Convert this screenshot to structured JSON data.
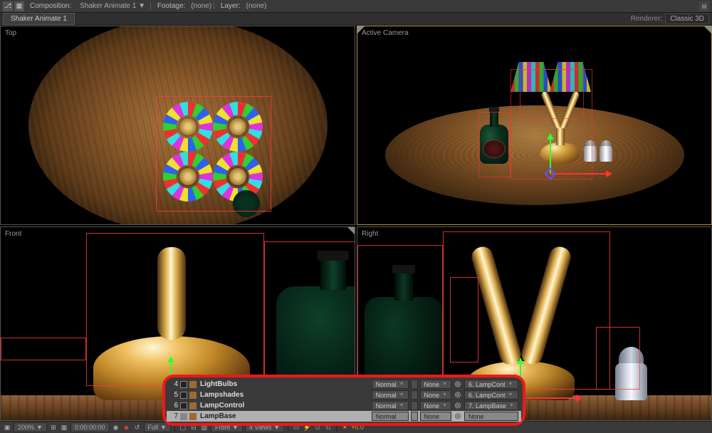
{
  "header": {
    "comp_label": "Composition:",
    "comp_name": "Shaker Animate 1",
    "footage_label": "Footage:",
    "footage_value": "(none)",
    "layer_label": "Layer:",
    "layer_value": "(none)"
  },
  "tab": {
    "name": "Shaker Animate 1"
  },
  "renderer": {
    "label": "Renderer:",
    "value": "Classic 3D"
  },
  "viewports": {
    "top": "Top",
    "active": "Active Camera",
    "front": "Front",
    "right": "Right"
  },
  "layers": [
    {
      "num": "4",
      "name": "LightBulbs",
      "mode": "Normal",
      "trk": "None",
      "parent": "6. LampCont"
    },
    {
      "num": "5",
      "name": "Lampshades",
      "mode": "Normal",
      "trk": "None",
      "parent": "6. LampCont"
    },
    {
      "num": "6",
      "name": "LampControl",
      "mode": "Normal",
      "trk": "None",
      "parent": "7. LampBase"
    },
    {
      "num": "7",
      "name": "LampBase",
      "mode": "Normal",
      "trk": "None",
      "parent": "None",
      "selected": true
    }
  ],
  "status": {
    "zoom": "200%",
    "timecode": "0:00:00:00",
    "quality": "Full",
    "view": "Front",
    "layout": "4 Views",
    "exposure": "+0.0"
  }
}
